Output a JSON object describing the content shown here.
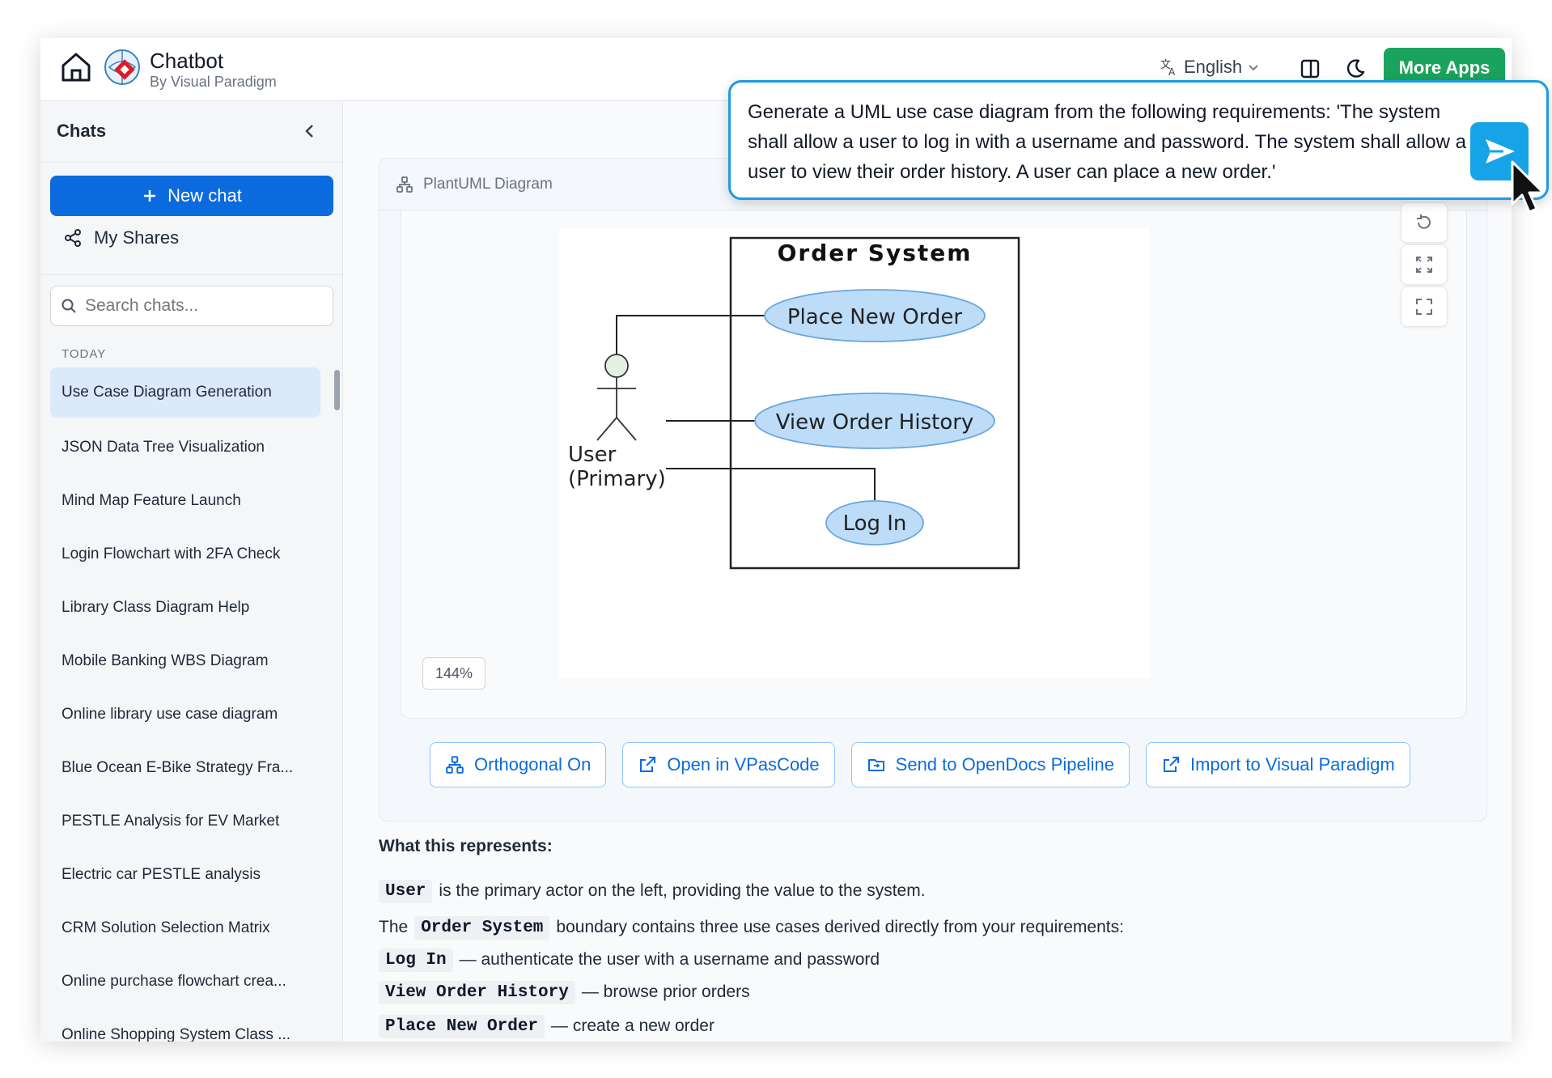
{
  "header": {
    "brand_title": "Chatbot",
    "brand_subtitle": "By Visual Paradigm",
    "language": "English",
    "more_apps": "More Apps"
  },
  "sidebar": {
    "title": "Chats",
    "new_chat": "New chat",
    "my_shares": "My Shares",
    "search_placeholder": "Search chats...",
    "section_label": "TODAY",
    "chats": [
      "Use Case Diagram Generation",
      "JSON Data Tree Visualization",
      "Mind Map Feature Launch",
      "Login Flowchart with 2FA Check",
      "Library Class Diagram Help",
      "Mobile Banking WBS Diagram",
      "Online library use case diagram",
      "Blue Ocean E-Bike Strategy Fra...",
      "PESTLE Analysis for EV Market",
      "Electric car PESTLE analysis",
      "CRM Solution Selection Matrix",
      "Online purchase flowchart crea...",
      "Online Shopping System Class ..."
    ]
  },
  "diagram_card": {
    "title": "PlantUML Diagram",
    "zoom": "144%",
    "diagram": {
      "system_name": "Order System",
      "actor": [
        "User",
        "(Primary)"
      ],
      "use_cases": [
        "Place New Order",
        "View Order History",
        "Log In"
      ]
    }
  },
  "actions": {
    "orthogonal": "Orthogonal On",
    "open_vpascode": "Open in VPasCode",
    "send_opendocs": "Send to OpenDocs Pipeline",
    "import_vp": "Import to Visual Paradigm"
  },
  "description": {
    "title": "What this represents:",
    "line1_code": "User",
    "line1_text": "is the primary actor on the left, providing the value to the system.",
    "line2_prefix": "The",
    "line2_code": "Order System",
    "line2_text": "boundary contains three use cases derived directly from your requirements:",
    "items": [
      {
        "code": "Log In",
        "text": "— authenticate the user with a username and password"
      },
      {
        "code": "View Order History",
        "text": "— browse prior orders"
      },
      {
        "code": "Place New Order",
        "text": "— create a new order"
      }
    ]
  },
  "prompt": {
    "text": "Generate a UML use case diagram from the following requirements: 'The system shall allow a user to log in with a username and password. The system shall allow a user to view their order history. A user can place a new order.'"
  },
  "colors": {
    "primary_blue": "#0b6bde",
    "more_apps_green": "#1aa35c",
    "use_case_fill": "#bcdcf8",
    "prompt_border": "#1e9be0"
  }
}
